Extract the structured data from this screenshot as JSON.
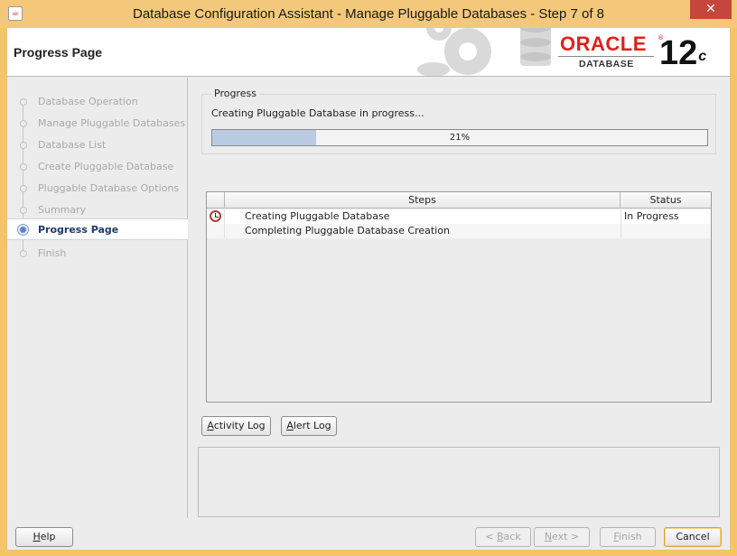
{
  "window": {
    "title": "Database Configuration Assistant - Manage Pluggable Databases - Step 7 of 8",
    "app_icon": "java-cup-icon",
    "close_glyph": "✕"
  },
  "header": {
    "page_title": "Progress Page",
    "logo": {
      "brand": "ORACLE",
      "registered": "®",
      "product": "DATABASE",
      "version": "12",
      "version_suffix": "c"
    }
  },
  "nav": {
    "items": [
      {
        "label": "Database Operation",
        "active": false
      },
      {
        "label": "Manage Pluggable Databases",
        "active": false
      },
      {
        "label": "Database List",
        "active": false
      },
      {
        "label": "Create Pluggable Database",
        "active": false
      },
      {
        "label": "Pluggable Database Options",
        "active": false
      },
      {
        "label": "Summary",
        "active": false
      },
      {
        "label": "Progress Page",
        "active": true
      },
      {
        "label": "Finish",
        "active": false
      }
    ]
  },
  "progress": {
    "legend": "Progress",
    "message": "Creating Pluggable Database in progress...",
    "percent": 21,
    "percent_label": "21%"
  },
  "steps_table": {
    "headers": {
      "icon": "",
      "steps": "Steps",
      "status": "Status"
    },
    "rows": [
      {
        "icon": "clock-icon",
        "step": "Creating Pluggable Database",
        "status": "In Progress"
      },
      {
        "icon": "",
        "step": "Completing Pluggable Database Creation",
        "status": ""
      }
    ]
  },
  "buttons": {
    "activity_log": {
      "mnemonic": "A",
      "rest": "ctivity Log"
    },
    "alert_log": {
      "mnemonic": "A",
      "rest": "lert Log"
    },
    "help": {
      "mnemonic": "H",
      "rest": "elp"
    },
    "back": {
      "prefix": "< ",
      "mnemonic": "B",
      "rest": "ack"
    },
    "next": {
      "mnemonic": "N",
      "rest": "ext >"
    },
    "finish": {
      "mnemonic": "F",
      "rest": "inish"
    },
    "cancel": {
      "label": "Cancel"
    }
  },
  "colors": {
    "titlebar": "#f4c87a",
    "close": "#c7463b",
    "oracle_red": "#e0201b",
    "progress_fill": "#b8cbe3",
    "nav_active_text": "#1f3a66"
  }
}
